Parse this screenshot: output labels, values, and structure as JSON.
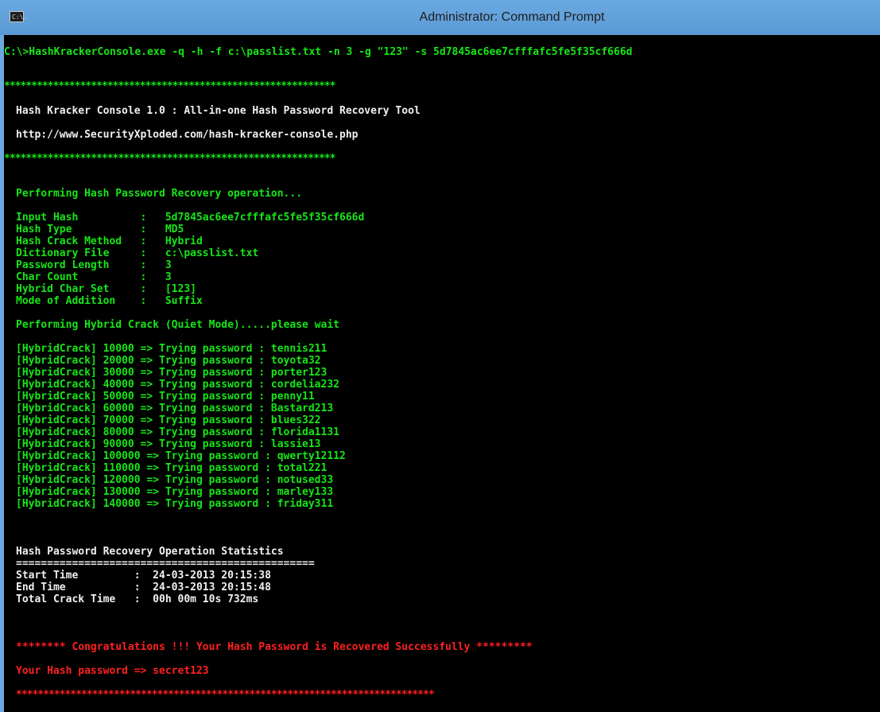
{
  "window": {
    "title": "Administrator: Command Prompt",
    "icon": "cmd-icon",
    "icon_label": "C:\\."
  },
  "colors": {
    "titlebar": "#5b9bd5",
    "console_bg": "#000000",
    "green_text": "#16e616",
    "white_text": "#f0f0f0",
    "red_text": "#ff2020"
  },
  "console": {
    "command": "C:\\>HashKrackerConsole.exe -q -h -f c:\\passlist.txt -n 3 -g \"123\" -s 5d7845ac6ee7cfffafc5fe5f35cf666d",
    "banner_stars": "*************************************************************",
    "banner_title": "Hash Kracker Console 1.0 : All-in-one Hash Password Recovery Tool",
    "banner_url": "http://www.SecurityXploded.com/hash-kracker-console.php",
    "performing_op": "Performing Hash Password Recovery operation...",
    "params": [
      "Input Hash          :   5d7845ac6ee7cfffafc5fe5f35cf666d",
      "Hash Type           :   MD5",
      "Hash Crack Method   :   Hybrid",
      "Dictionary File     :   c:\\passlist.txt",
      "Password Length     :   3",
      "Char Count          :   3",
      "Hybrid Char Set     :   [123]",
      "Mode of Addition    :   Suffix"
    ],
    "performing_crack": "Performing Hybrid Crack (Quiet Mode).....please wait",
    "attempts": [
      "[HybridCrack] 10000 => Trying password : tennis211",
      "[HybridCrack] 20000 => Trying password : toyota32",
      "[HybridCrack] 30000 => Trying password : porter123",
      "[HybridCrack] 40000 => Trying password : cordelia232",
      "[HybridCrack] 50000 => Trying password : penny11",
      "[HybridCrack] 60000 => Trying password : Bastard213",
      "[HybridCrack] 70000 => Trying password : blues322",
      "[HybridCrack] 80000 => Trying password : florida1131",
      "[HybridCrack] 90000 => Trying password : lassie13",
      "[HybridCrack] 100000 => Trying password : qwerty12112",
      "[HybridCrack] 110000 => Trying password : total221",
      "[HybridCrack] 120000 => Trying password : notused33",
      "[HybridCrack] 130000 => Trying password : marley133",
      "[HybridCrack] 140000 => Trying password : friday311"
    ],
    "stats_title": "Hash Password Recovery Operation Statistics",
    "stats_rule": "================================================",
    "stats": [
      "Start Time         :  24-03-2013 20:15:38",
      "End Time           :  24-03-2013 20:15:48",
      "Total Crack Time   :  00h 00m 10s 732ms"
    ],
    "congrats": "******** Congratulations !!! Your Hash Password is Recovered Successfully *********",
    "result": "Your Hash password => secret123",
    "end_stars": "*****************************************************************************"
  }
}
